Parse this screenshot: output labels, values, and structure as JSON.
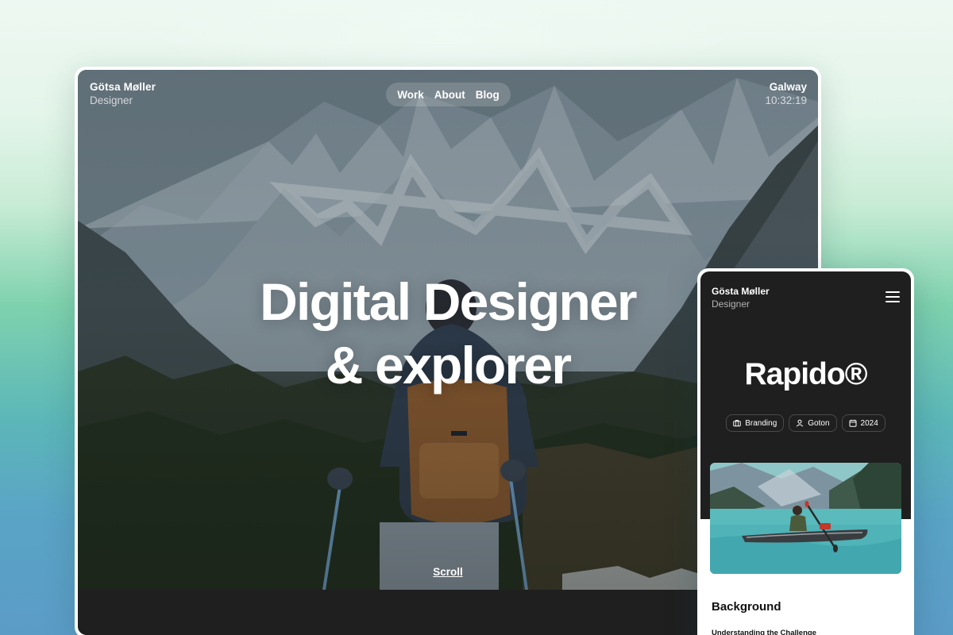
{
  "desktop": {
    "brand": {
      "name": "Götsa Møller",
      "role": "Designer"
    },
    "nav": [
      {
        "label": "Work"
      },
      {
        "label": "About"
      },
      {
        "label": "Blog"
      }
    ],
    "locale": {
      "city": "Galway",
      "time": "10:32:19"
    },
    "headline": {
      "line1": "Digital Designer",
      "line2": "& explorer"
    },
    "scroll_label": "Scroll"
  },
  "mobile": {
    "brand": {
      "name": "Gösta Møller",
      "role": "Designer"
    },
    "title": "Rapido®",
    "tags": [
      {
        "label": "Branding",
        "icon": "briefcase-icon"
      },
      {
        "label": "Goton",
        "icon": "user-icon"
      },
      {
        "label": "2024",
        "icon": "calendar-icon"
      }
    ],
    "section": {
      "title": "Background",
      "subtitle": "Understanding the Challenge"
    }
  },
  "colors": {
    "background_top": "#eef8f2",
    "background_mid": "#7fd2ae",
    "background_bottom": "#5b9cc7",
    "dark_surface": "#1f1f1f",
    "text_light": "#ffffff"
  }
}
